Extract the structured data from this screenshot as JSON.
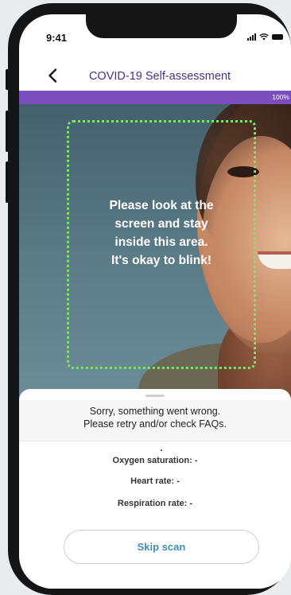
{
  "status_bar": {
    "time": "9:41"
  },
  "nav": {
    "title": "COVID-19 Self-assessment",
    "back_icon": "chevron-left-icon"
  },
  "progress": {
    "label": "100%",
    "value": 100,
    "color": "#7a4fbd"
  },
  "camera": {
    "scan_message_lines": [
      "Please look at the",
      "screen and stay",
      "inside this area.",
      "It's okay to blink!"
    ],
    "frame_color": "#7ee36a"
  },
  "result_sheet": {
    "error_lines": [
      "Sorry, something went wrong.",
      "Please retry and/or check FAQs."
    ],
    "metrics": {
      "oxygen": "Oxygen saturation: -",
      "heart": "Heart rate: -",
      "respiration": "Respiration rate: -"
    },
    "skip_label": "Skip scan",
    "accent": "#3e8fb0"
  }
}
